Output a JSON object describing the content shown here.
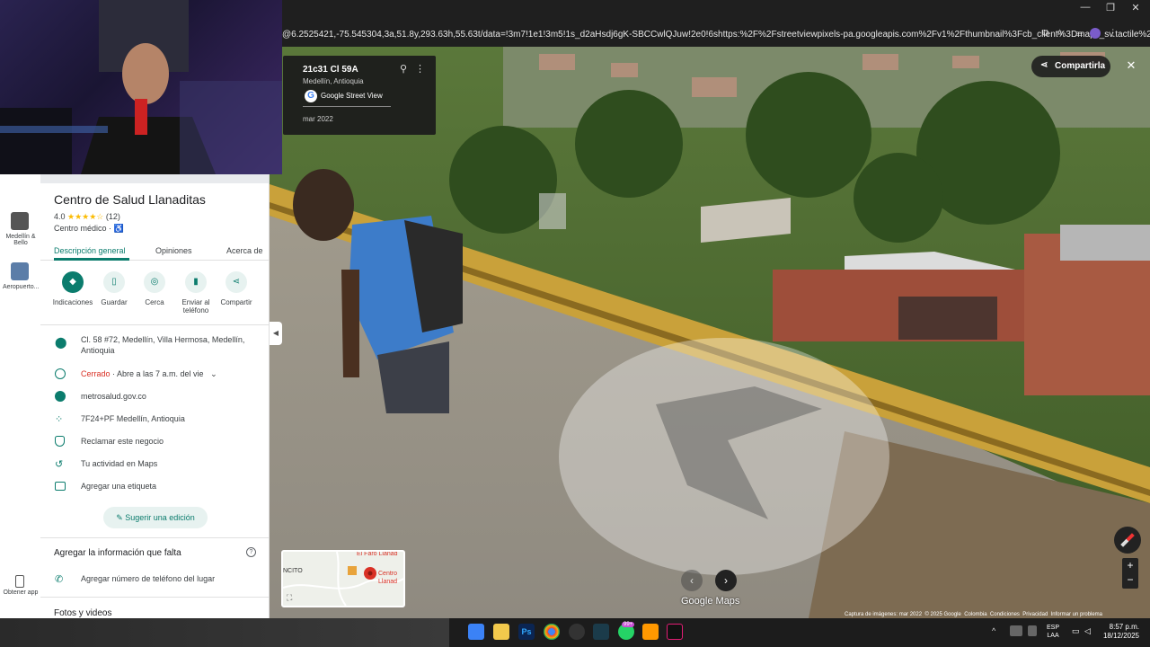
{
  "browser": {
    "url": "@6.2525421,-75.545304,3a,51.8y,293.63h,55.63t/data=!3m7!1e1!3m5!1s_d2aHsdj6gK-SBCCwlQJuw!2e0!6shttps:%2F%2Fstreetviewpixels-pa.googleapis.com%2Fv1%2Fthumbnail%3Fcb_client%3Dmaps_sv.tactile%26w%..."
  },
  "streetview": {
    "address": "21c31 Cl 59A",
    "city": "Medellín, Antioquia",
    "source": "Google Street View",
    "date": "mar 2022",
    "share_label": "Compartirla",
    "watermark": "Google Maps",
    "footer": {
      "capture": "Captura de imágenes: mar 2022",
      "copyright": "© 2025 Google",
      "country": "Colombia",
      "terms": "Condiciones",
      "privacy": "Privacidad",
      "report": "Informar un problema"
    }
  },
  "rail": {
    "item1_label": "Medellín & Bello",
    "item2_label": "Aeropuerto...",
    "bottom_label": "Obtener app"
  },
  "place": {
    "name": "Centro de Salud Llanaditas",
    "rating": "4.0",
    "stars": "★★★★☆",
    "reviews": "(12)",
    "category": "Centro médico · ♿",
    "tabs": [
      "Descripción general",
      "Opiniones",
      "Acerca de"
    ],
    "actions": [
      "Indicaciones",
      "Guardar",
      "Cerca",
      "Enviar al teléfono",
      "Compartir"
    ],
    "address": "Cl. 58 #72, Medellín, Villa Hermosa, Medellín, Antioquia",
    "status": "Cerrado",
    "hours": " · Abre a las 7 a.m. del vie",
    "website": "metrosalud.gov.co",
    "pluscode": "7F24+PF Medellín, Antioquia",
    "claim": "Reclamar este negocio",
    "activity": "Tu actividad en Maps",
    "label_tag": "Agregar una etiqueta",
    "suggest": "Sugerir una edición",
    "missing_title": "Agregar la información que falta",
    "add_phone": "Agregar número de teléfono del lugar",
    "photos": "Fotos y videos"
  },
  "minimap": {
    "label1": "El Faro Llanad",
    "label2": "NCITO",
    "label3": "Centro Llanad"
  },
  "taskbar": {
    "lang": "ESP",
    "lang2": "LAA",
    "time": "8:57 p.m.",
    "date": "18/12/2025",
    "badge": "99+"
  },
  "colors": {
    "accent": "#0b7c6d",
    "closed": "#d93025",
    "link": "#0b57d0"
  }
}
